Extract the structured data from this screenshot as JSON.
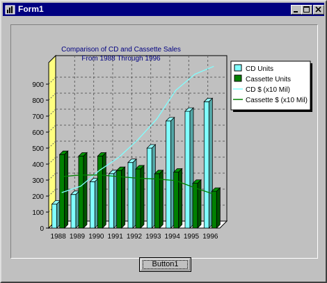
{
  "window": {
    "title": "Form1",
    "app_icon": "vb-form-icon"
  },
  "title_buttons": [
    "minimize-icon",
    "maximize-icon",
    "close-icon"
  ],
  "button": {
    "label": "Button1"
  },
  "chart_data": {
    "type": "bar",
    "title": [
      "Comparison of CD and Cassette Sales",
      "From 1988 Through 1996"
    ],
    "categories": [
      "1988",
      "1989",
      "1990",
      "1991",
      "1992",
      "1993",
      "1994",
      "1995",
      "1996"
    ],
    "ylim": [
      0,
      1000
    ],
    "yticks": [
      0,
      100,
      200,
      300,
      400,
      500,
      600,
      700,
      800,
      900
    ],
    "grid": true,
    "legend_position": "top-right",
    "series": [
      {
        "name": "CD Units",
        "kind": "bar",
        "color": "#80ffff",
        "values": [
          150,
          210,
          290,
          340,
          410,
          500,
          670,
          730,
          790
        ]
      },
      {
        "name": "Cassette Units",
        "kind": "bar",
        "color": "#008000",
        "values": [
          460,
          450,
          450,
          360,
          370,
          340,
          350,
          280,
          230
        ]
      },
      {
        "name": "CD $ (x10 Mil)",
        "kind": "line",
        "color": "#80ffff",
        "values": [
          200,
          240,
          340,
          420,
          530,
          660,
          840,
          940,
          990
        ]
      },
      {
        "name": "Cassette $ (x10 Mil)",
        "kind": "line",
        "color": "#008000",
        "values": [
          300,
          310,
          310,
          300,
          290,
          285,
          275,
          230,
          190
        ]
      }
    ]
  }
}
